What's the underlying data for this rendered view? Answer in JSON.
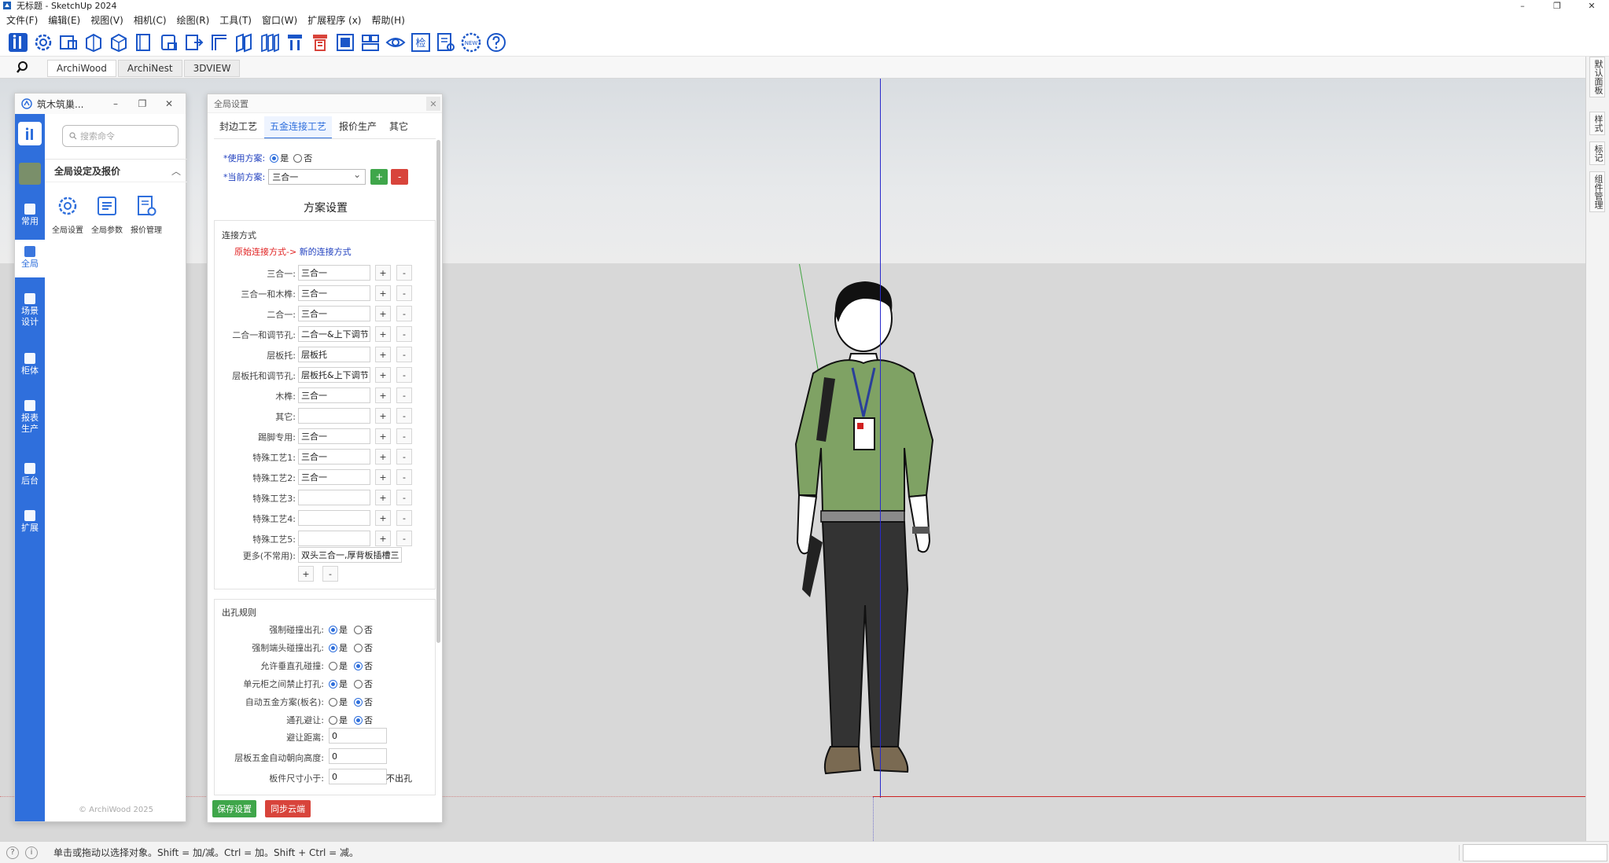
{
  "window": {
    "title": "无标题 - SketchUp 2024",
    "min": "–",
    "max": "❐",
    "close": "✕"
  },
  "menu": [
    "文件(F)",
    "编辑(E)",
    "视图(V)",
    "相机(C)",
    "绘图(R)",
    "工具(T)",
    "窗口(W)",
    "扩展程序 (x)",
    "帮助(H)"
  ],
  "toolbar_icons": [
    "archiwood-logo-icon",
    "settings-gear-icon",
    "panel-icon",
    "cabinet-icon",
    "box-icon",
    "door-icon",
    "drawer-icon",
    "export-icon",
    "frame-icon",
    "shelf-icon",
    "board-icon",
    "hardware-icon",
    "drill-icon",
    "select-box-icon",
    "layout-icon",
    "eye-icon",
    "check-text-icon",
    "report-icon",
    "new-badge-icon",
    "help-icon"
  ],
  "toolbar_check_label": "检",
  "toolbar_new_label": "NEW",
  "tabs": [
    "ArchiWood",
    "ArchiNest",
    "3DVIEW"
  ],
  "right_tabs": [
    "默认面板",
    "样式",
    "标记",
    "组件管理"
  ],
  "status": {
    "message": "单击或拖动以选择对象。Shift = 加/减。Ctrl = 加。Shift + Ctrl = 减。"
  },
  "plugin": {
    "title": "筑木筑巢...",
    "search_placeholder": "搜索命令",
    "nav": [
      {
        "label": "常用"
      },
      {
        "label": "全局"
      },
      {
        "label": "场景设计"
      },
      {
        "label": "柜体"
      },
      {
        "label": "报表生产"
      },
      {
        "label": "后台"
      },
      {
        "label": "扩展"
      }
    ],
    "section_title": "全局设定及报价",
    "tools": [
      "全局设置",
      "全局参数",
      "报价管理"
    ],
    "copyright": "© ArchiWood 2025"
  },
  "dialog": {
    "title": "全局设置",
    "tabs": [
      "封边工艺",
      "五金连接工艺",
      "报价生产",
      "其它"
    ],
    "active_tab": 1,
    "use_scheme_label": "*使用方案:",
    "yes": "是",
    "no": "否",
    "current_scheme_label": "*当前方案:",
    "current_scheme_value": "三合一",
    "plus": "+",
    "minus": "-",
    "scheme_settings": "方案设置",
    "connection_title": "连接方式",
    "mapping_original": "原始连接方式->",
    "mapping_new": "新的连接方式",
    "connections": [
      {
        "label": "三合一:",
        "value": "三合一"
      },
      {
        "label": "三合一和木榫:",
        "value": "三合一"
      },
      {
        "label": "二合一:",
        "value": "三合一"
      },
      {
        "label": "二合一和调节孔:",
        "value": "二合一&上下调节"
      },
      {
        "label": "层板托:",
        "value": "层板托"
      },
      {
        "label": "层板托和调节孔:",
        "value": "层板托&上下调节"
      },
      {
        "label": "木榫:",
        "value": "三合一"
      },
      {
        "label": "其它:",
        "value": ""
      },
      {
        "label": "踢脚专用:",
        "value": "三合一"
      },
      {
        "label": "特殊工艺1:",
        "value": "三合一"
      },
      {
        "label": "特殊工艺2:",
        "value": "三合一"
      },
      {
        "label": "特殊工艺3:",
        "value": ""
      },
      {
        "label": "特殊工艺4:",
        "value": ""
      },
      {
        "label": "特殊工艺5:",
        "value": ""
      }
    ],
    "more_label": "更多(不常用):",
    "more_value": "双头三合一,厚背板插槽三",
    "drill_title": "出孔规则",
    "drill_rules": [
      {
        "label": "强制碰撞出孔:",
        "selected": "是"
      },
      {
        "label": "强制端头碰撞出孔:",
        "selected": "是"
      },
      {
        "label": "允许垂直孔碰撞:",
        "selected": "否"
      },
      {
        "label": "单元柜之间禁止打孔:",
        "selected": "是"
      },
      {
        "label": "自动五金方案(板名):",
        "selected": "否"
      },
      {
        "label": "通孔避让:",
        "selected": "否"
      }
    ],
    "avoid_distance_label": "避让距离:",
    "avoid_distance_value": "0",
    "shelf_height_label": "层板五金自动朝向高度:",
    "shelf_height_value": "0",
    "panel_size_label": "板件尺寸小于:",
    "panel_size_value": "0",
    "panel_size_suffix": "不出孔",
    "save": "保存设置",
    "sync": "同步云端"
  },
  "colors": {
    "accent": "#2f6fdc",
    "green": "#3fa64a",
    "red": "#d8443b",
    "axis_red": "#cc2222",
    "axis_blue": "#2a2acc"
  }
}
